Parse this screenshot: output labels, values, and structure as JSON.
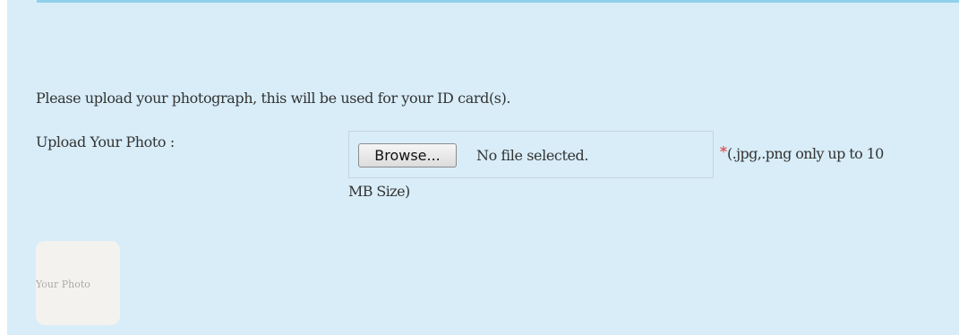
{
  "form": {
    "instruction": "Please upload your photograph, this will be used for your ID card(s).",
    "upload_label": "Upload Your Photo :",
    "browse_label": "Browse...",
    "file_status": "No file selected.",
    "required_marker": "*",
    "format_hint_line1": "(.jpg,.png only up to 10",
    "format_hint_line2": "MB Size)",
    "photo_placeholder": "Your Photo"
  },
  "colors": {
    "panel_background": "#d8edf8",
    "top_border": "#8fd0ea",
    "required_marker": "#e0322d",
    "text": "#333333",
    "placeholder_background": "#f4f2ef"
  }
}
